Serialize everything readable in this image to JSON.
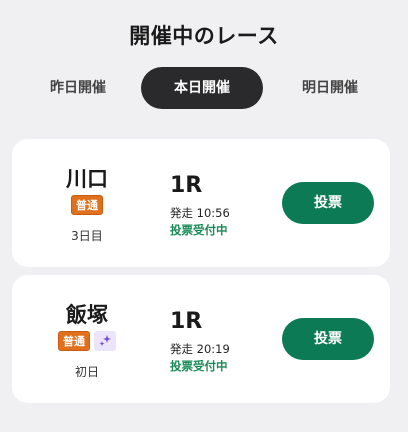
{
  "header": {
    "title": "開催中のレース"
  },
  "tabs": [
    {
      "label": "昨日開催",
      "active": false
    },
    {
      "label": "本日開催",
      "active": true
    },
    {
      "label": "明日開催",
      "active": false
    }
  ],
  "races": [
    {
      "venue": "川口",
      "grade_badge": "普通",
      "night_icon": false,
      "day": "3日目",
      "race_number": "1R",
      "start_time": "発走 10:56",
      "status": "投票受付中",
      "vote_label": "投票"
    },
    {
      "venue": "飯塚",
      "grade_badge": "普通",
      "night_icon": true,
      "day": "初日",
      "race_number": "1R",
      "start_time": "発走 20:19",
      "status": "投票受付中",
      "vote_label": "投票"
    }
  ],
  "colors": {
    "accent": "#0c7a55",
    "status": "#1a8a55",
    "badge": "#e0701e",
    "active_tab": "#2a2a2c"
  },
  "icons": {
    "night": "stars-icon"
  }
}
